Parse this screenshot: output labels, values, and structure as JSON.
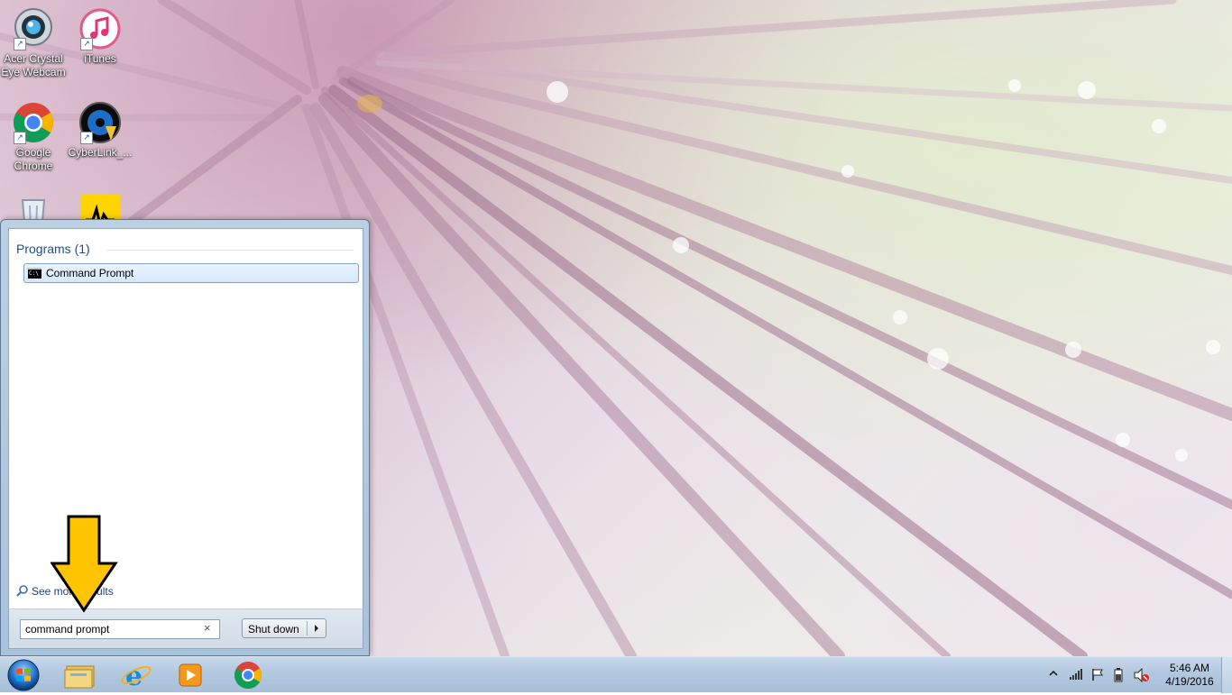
{
  "desktop": {
    "icons": [
      {
        "label": "Acer Crystal Eye Webcam",
        "icon": "webcam-icon"
      },
      {
        "label": "iTunes",
        "icon": "itunes-icon"
      },
      {
        "label": "Google Chrome",
        "icon": "chrome-icon"
      },
      {
        "label": "CyberLink_...",
        "icon": "cyberlink-icon"
      },
      {
        "label": "",
        "icon": "recycle-bin-icon"
      },
      {
        "label": "",
        "icon": "audio-app-icon"
      }
    ],
    "icon_label_lines": {
      "acer_line1": "Acer Crystal",
      "acer_line2": "Eye Webcam",
      "itunes": "iTunes",
      "chrome_line1": "Google",
      "chrome_line2": "Chrome",
      "cyberlink": "CyberLink_..."
    }
  },
  "start_menu": {
    "section_title": "Programs (1)",
    "results": [
      {
        "label": "Command Prompt",
        "icon": "cmd-icon",
        "selected": true
      }
    ],
    "see_more_label": "See more results",
    "search": {
      "value": "command prompt",
      "clear_icon": "close-icon"
    },
    "shutdown_label": "Shut down"
  },
  "taskbar": {
    "start_icon": "windows-start-orb-icon",
    "pinned": [
      "file-explorer-icon",
      "internet-explorer-icon",
      "media-player-icon",
      "chrome-icon"
    ],
    "tray_icons": [
      "show-hidden-icons-chevron",
      "signal-icon",
      "flag-icon",
      "battery-icon",
      "volume-muted-icon"
    ],
    "time": "5:46 AM",
    "date": "4/19/2016"
  },
  "colors": {
    "arrow_yellow": "#ffc400",
    "selection_border": "#7da2ce",
    "section_title_blue": "#1e4b8c"
  }
}
